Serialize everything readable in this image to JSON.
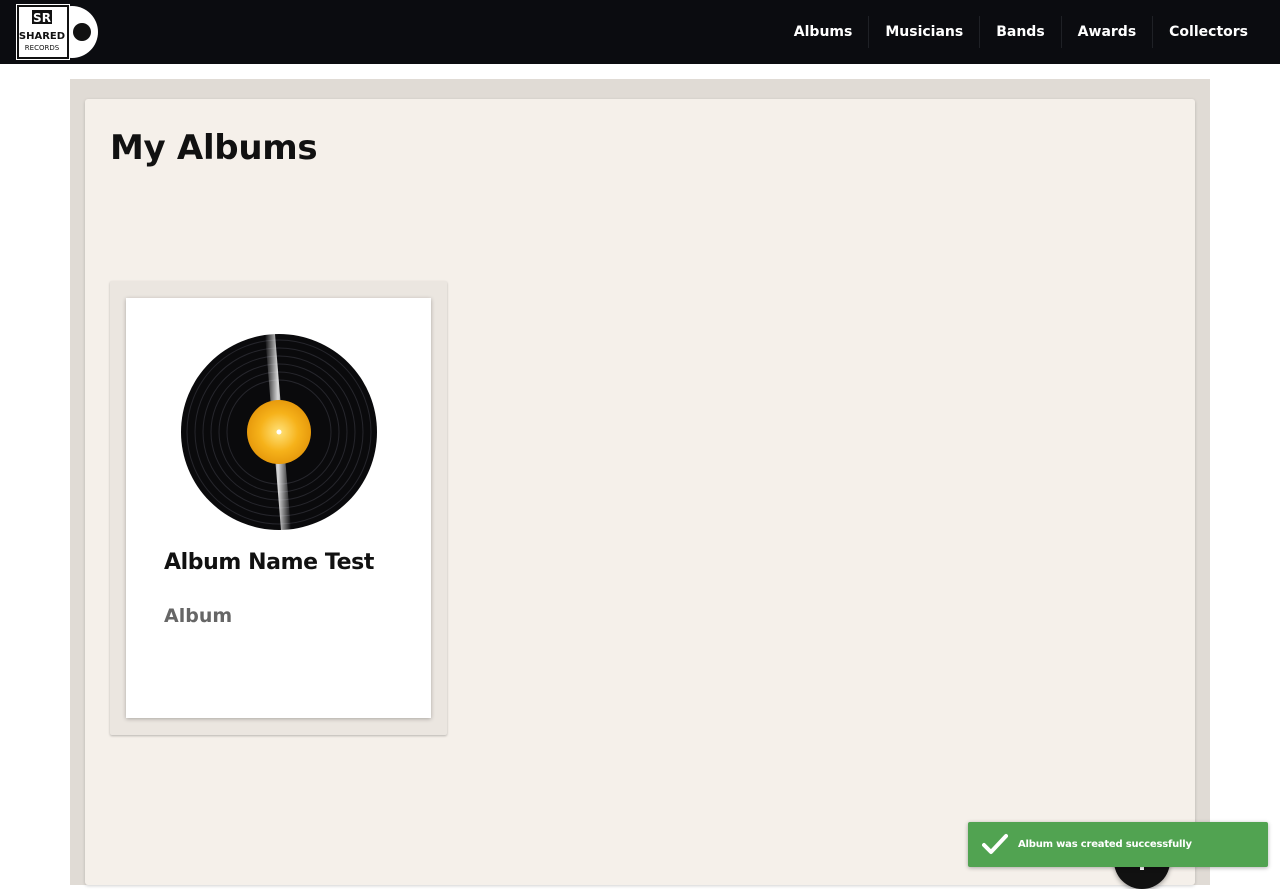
{
  "logo": {
    "name": "shared-records-logo",
    "line1": "SR",
    "line2": "SHARED",
    "line3": "RECORDS"
  },
  "nav": {
    "items": [
      "Albums",
      "Musicians",
      "Bands",
      "Awards",
      "Collectors"
    ]
  },
  "page": {
    "title": "My Albums"
  },
  "albums": [
    {
      "name": "Album Name Test",
      "type": "Album",
      "image": "vinyl-record-icon"
    }
  ],
  "fab": {
    "icon": "plus-icon",
    "label": "+"
  },
  "toast": {
    "icon": "check-icon",
    "message": "Album was created successfully"
  },
  "colors": {
    "navbar": "#0b0c10",
    "panel": "#f5f0ea",
    "outer": "#e0dbd5",
    "toast": "#51a351",
    "vinyl_label": "#f6b21a"
  }
}
